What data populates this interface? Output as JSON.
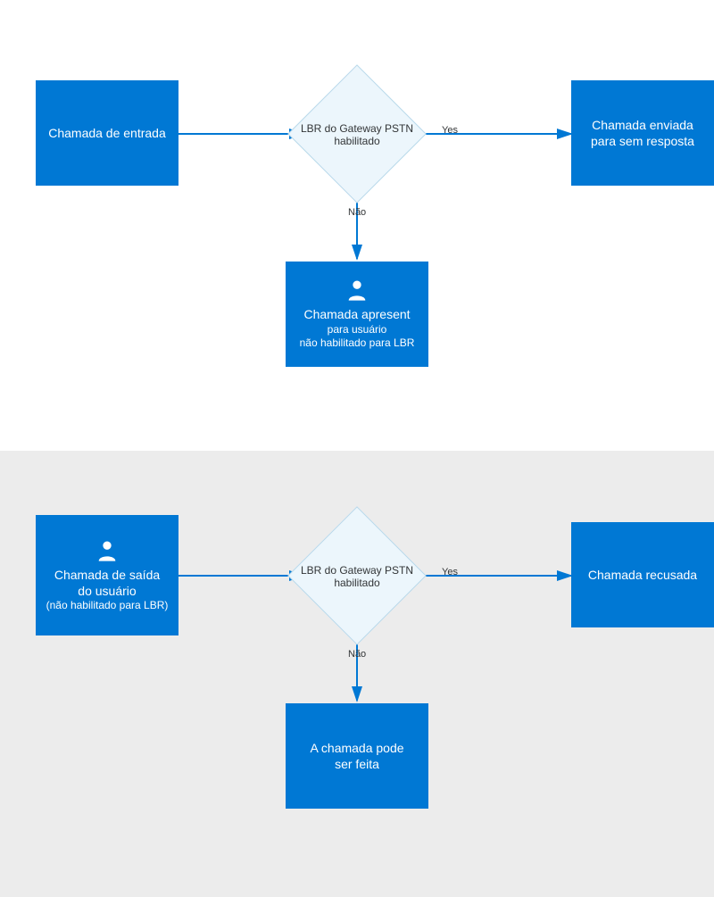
{
  "top": {
    "start": "Chamada de entrada",
    "decision": "LBR do Gateway PSTN habilitado",
    "yes_label": "Yes",
    "no_label": "Não",
    "right_line1": "Chamada enviada",
    "right_line2": "para sem resposta",
    "down_line1": "Chamada apresent",
    "down_line2": "para usuário",
    "down_line3": "não habilitado para LBR"
  },
  "bottom": {
    "start_line1": "Chamada de saída",
    "start_line2": "do usuário",
    "start_line3": "(não habilitado para LBR)",
    "decision": "LBR do Gateway PSTN habilitado",
    "yes_label": "Yes",
    "no_label": "Não",
    "right": "Chamada recusada",
    "down_line1": "A chamada pode",
    "down_line2": "ser feita"
  }
}
